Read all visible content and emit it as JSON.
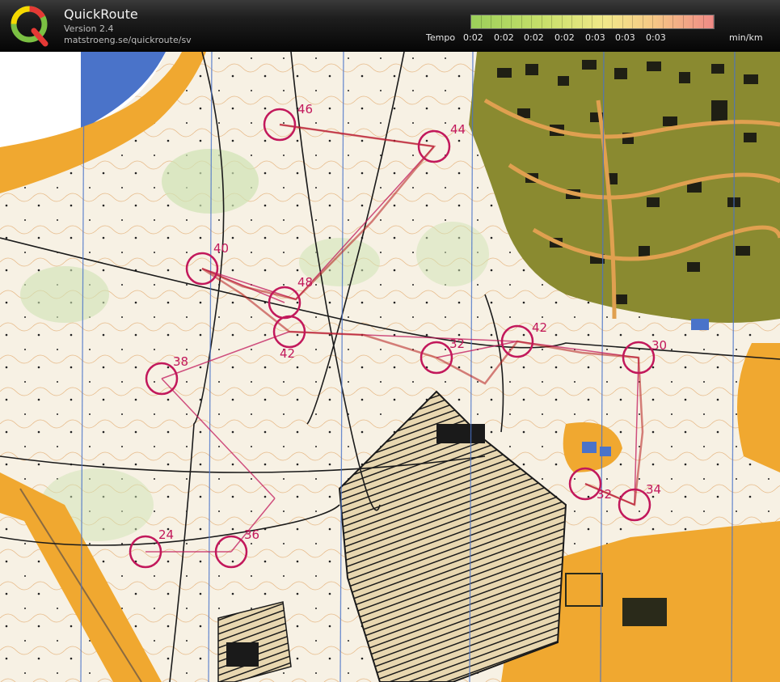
{
  "app": {
    "title": "QuickRoute",
    "version": "Version 2.4",
    "url": "matstroeng.se/quickroute/sv"
  },
  "legend": {
    "label": "Tempo",
    "ticks": [
      "0:02",
      "0:02",
      "0:02",
      "0:02",
      "0:03",
      "0:03",
      "0:03"
    ],
    "unit": "min/km"
  },
  "colors": {
    "control": "#c2185b",
    "route": "#b71c1c",
    "water": "#4a73c9",
    "open_land": "#f0a830",
    "building": "#2a2a1a",
    "urban_green": "#8a8a30"
  },
  "controls": [
    {
      "number": "46"
    },
    {
      "number": "44"
    },
    {
      "number": "40"
    },
    {
      "number": "48"
    },
    {
      "number": "42"
    },
    {
      "number": "38"
    },
    {
      "number": "32"
    },
    {
      "number": "42"
    },
    {
      "number": "30"
    },
    {
      "number": "32"
    },
    {
      "number": "34"
    },
    {
      "number": "24"
    },
    {
      "number": "36"
    }
  ]
}
